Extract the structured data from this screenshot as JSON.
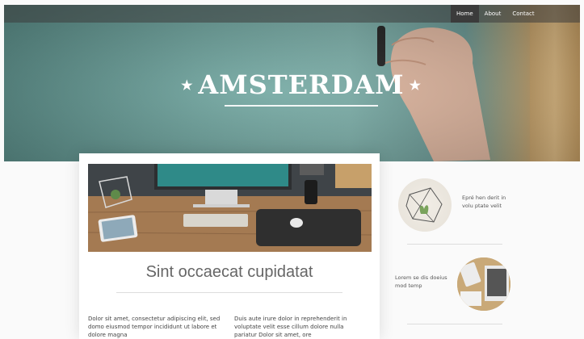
{
  "nav": {
    "items": [
      {
        "label": "Home",
        "active": true
      },
      {
        "label": "About",
        "active": false
      },
      {
        "label": "Contact",
        "active": false
      }
    ]
  },
  "hero": {
    "title": "AMSTERDAM",
    "star_left": "★",
    "star_right": "★"
  },
  "article": {
    "heading": "Sint occaecat cupidatat",
    "col1": "Dolor sit amet, consectetur adipiscing elit, sed domo eiusmod tempor incididunt ut labore et dolore magna",
    "col2": "Duis aute irure dolor in reprehenderit in voluptate velit esse cillum dolore nulla pariatur Dolor sit amet, ore"
  },
  "sidebar": {
    "items": [
      {
        "text": "Epré hen derit in volu ptate velit"
      },
      {
        "text": "Lorem se dis doeius mod temp"
      }
    ]
  },
  "colors": {
    "hero_teal": "#6fa49e",
    "nav_bg": "#3b3b3b",
    "wood": "#d8b47a"
  }
}
